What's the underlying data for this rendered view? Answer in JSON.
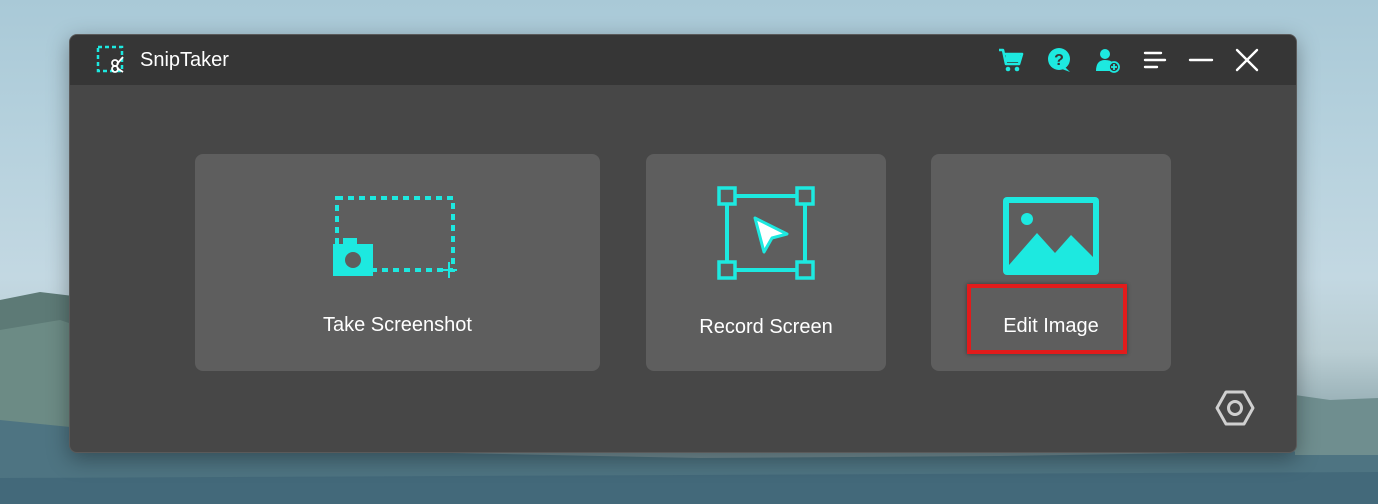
{
  "app": {
    "title": "SnipTaker",
    "accent_color": "#1de9e0"
  },
  "titlebar": {
    "icons": [
      "cart-icon",
      "help-icon",
      "account-icon",
      "menu-icon",
      "minimize-icon",
      "close-icon"
    ]
  },
  "main": {
    "cards": [
      {
        "label": "Take Screenshot",
        "icon": "screenshot-icon"
      },
      {
        "label": "Record Screen",
        "icon": "record-screen-icon"
      },
      {
        "label": "Edit Image",
        "icon": "image-icon",
        "highlighted": true,
        "highlight_color": "#e21b1b"
      }
    ]
  },
  "footer": {
    "settings_icon": "settings-icon"
  }
}
